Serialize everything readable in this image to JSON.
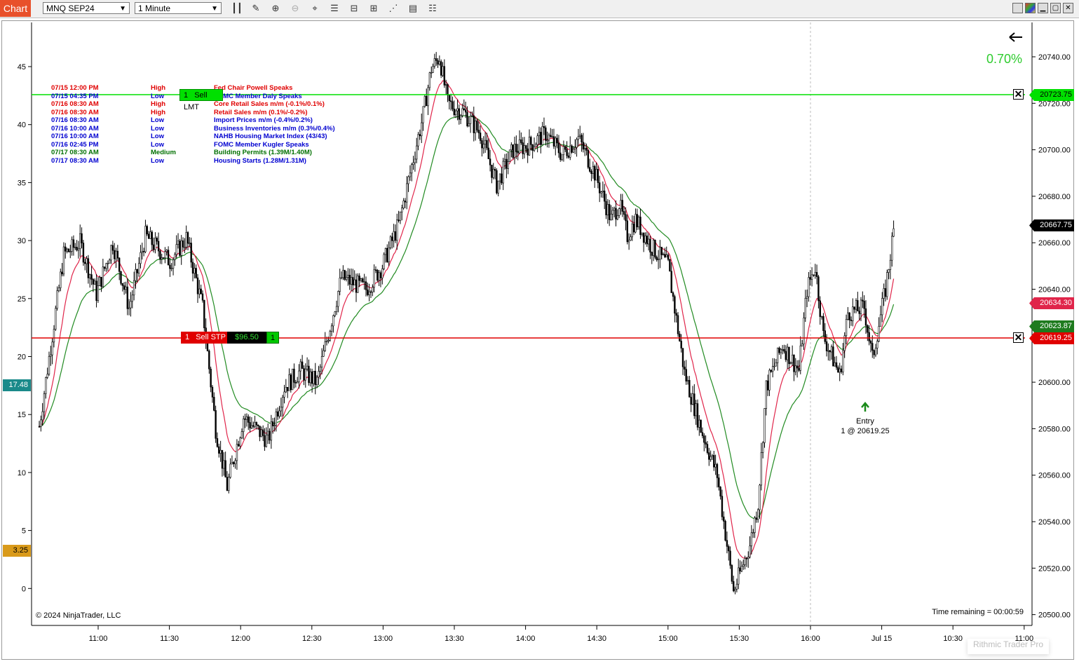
{
  "toolbar": {
    "tab_label": "Chart",
    "instrument": "MNQ SEP24",
    "interval": "1 Minute"
  },
  "chart": {
    "change_pct": "0.70%",
    "copyright": "© 2024 NinjaTrader, LLC",
    "time_remaining": "Time remaining = 00:00:59",
    "watermark": "Rithmic Trader Pro",
    "entry_label": "Entry",
    "entry_detail": "1 @ 20619.25",
    "left_axis": {
      "ticks": [
        "45",
        "40",
        "35",
        "30",
        "25",
        "20",
        "15",
        "10",
        "5",
        "0"
      ],
      "tag_teal": "17.48",
      "tag_gold": "3.25"
    },
    "right_axis": {
      "ticks": [
        "20740.00",
        "20720.00",
        "20700.00",
        "20680.00",
        "20660.00",
        "20640.00",
        "20620.00",
        "20600.00",
        "20580.00",
        "20560.00",
        "20540.00",
        "20520.00",
        "20500.00"
      ],
      "tag_lmt": "20723.75",
      "tag_last": "20667.75",
      "tag_red_ma": "20634.30",
      "tag_green_ma": "20623.87",
      "tag_stp": "20619.25"
    },
    "time_axis": [
      "11:00",
      "11:30",
      "12:00",
      "12:30",
      "13:00",
      "13:30",
      "14:00",
      "14:30",
      "15:00",
      "15:30",
      "16:00",
      "Jul 15",
      "10:30",
      "11:00"
    ],
    "orders": {
      "lmt_qty": "1",
      "lmt_label": "Sell LMT",
      "stp_qty": "1",
      "stp_label": "Sell STP",
      "stp_pnl": "$96.50",
      "stp_position": "1"
    },
    "colors": {
      "limit_line": "#00e000",
      "stop_line": "#e00000",
      "fast_ma": "#e0254a",
      "slow_ma": "#228b22",
      "change": "#2ecc2e"
    }
  },
  "events": [
    {
      "time": "07/15 12:00 PM",
      "impact": "High",
      "desc": "Fed Chair Powell Speaks",
      "color": "#e00000"
    },
    {
      "time": "07/15 04:35 PM",
      "impact": "Low",
      "desc": "FOMC Member Daly Speaks",
      "color": "#0000d0"
    },
    {
      "time": "07/16 08:30 AM",
      "impact": "High",
      "desc": "Core Retail Sales m/m (-0.1%/0.1%)",
      "color": "#e00000"
    },
    {
      "time": "07/16 08:30 AM",
      "impact": "High",
      "desc": "Retail Sales m/m (0.1%/-0.2%)",
      "color": "#e00000"
    },
    {
      "time": "07/16 08:30 AM",
      "impact": "Low",
      "desc": "Import Prices m/m (-0.4%/0.2%)",
      "color": "#0000d0"
    },
    {
      "time": "07/16 10:00 AM",
      "impact": "Low",
      "desc": "Business Inventories m/m (0.3%/0.4%)",
      "color": "#0000d0"
    },
    {
      "time": "07/16 10:00 AM",
      "impact": "Low",
      "desc": "NAHB Housing Market Index (43/43)",
      "color": "#0000d0"
    },
    {
      "time": "07/16 02:45 PM",
      "impact": "Low",
      "desc": "FOMC Member Kugler Speaks",
      "color": "#0000d0"
    },
    {
      "time": "07/17 08:30 AM",
      "impact": "Medium",
      "desc": "Building Permits (1.39M/1.40M)",
      "color": "#007000"
    },
    {
      "time": "07/17 08:30 AM",
      "impact": "Low",
      "desc": "Housing Starts (1.28M/1.31M)",
      "color": "#0000d0"
    }
  ],
  "price_path": {
    "anchors": [
      [
        0,
        20581
      ],
      [
        15,
        20655
      ],
      [
        25,
        20660
      ],
      [
        35,
        20638
      ],
      [
        45,
        20660
      ],
      [
        55,
        20632
      ],
      [
        65,
        20663
      ],
      [
        80,
        20652
      ],
      [
        90,
        20662
      ],
      [
        100,
        20632
      ],
      [
        108,
        20580
      ],
      [
        115,
        20555
      ],
      [
        125,
        20585
      ],
      [
        140,
        20575
      ],
      [
        150,
        20598
      ],
      [
        160,
        20605
      ],
      [
        170,
        20600
      ],
      [
        185,
        20645
      ],
      [
        200,
        20640
      ],
      [
        210,
        20650
      ],
      [
        220,
        20668
      ],
      [
        235,
        20715
      ],
      [
        240,
        20735
      ],
      [
        245,
        20740
      ],
      [
        250,
        20720
      ],
      [
        260,
        20716
      ],
      [
        270,
        20707
      ],
      [
        280,
        20685
      ],
      [
        290,
        20700
      ],
      [
        300,
        20702
      ],
      [
        310,
        20707
      ],
      [
        320,
        20698
      ],
      [
        330,
        20705
      ],
      [
        340,
        20690
      ],
      [
        350,
        20670
      ],
      [
        355,
        20677
      ],
      [
        360,
        20663
      ],
      [
        365,
        20670
      ],
      [
        375,
        20658
      ],
      [
        385,
        20650
      ],
      [
        395,
        20604
      ],
      [
        405,
        20580
      ],
      [
        415,
        20560
      ],
      [
        425,
        20510
      ],
      [
        435,
        20530
      ],
      [
        440,
        20548
      ],
      [
        445,
        20598
      ],
      [
        455,
        20616
      ],
      [
        465,
        20605
      ],
      [
        470,
        20640
      ],
      [
        475,
        20650
      ],
      [
        480,
        20620
      ],
      [
        490,
        20603
      ],
      [
        495,
        20630
      ],
      [
        505,
        20632
      ],
      [
        510,
        20610
      ],
      [
        518,
        20640
      ],
      [
        523,
        20665
      ]
    ],
    "volatility": 4.2
  }
}
